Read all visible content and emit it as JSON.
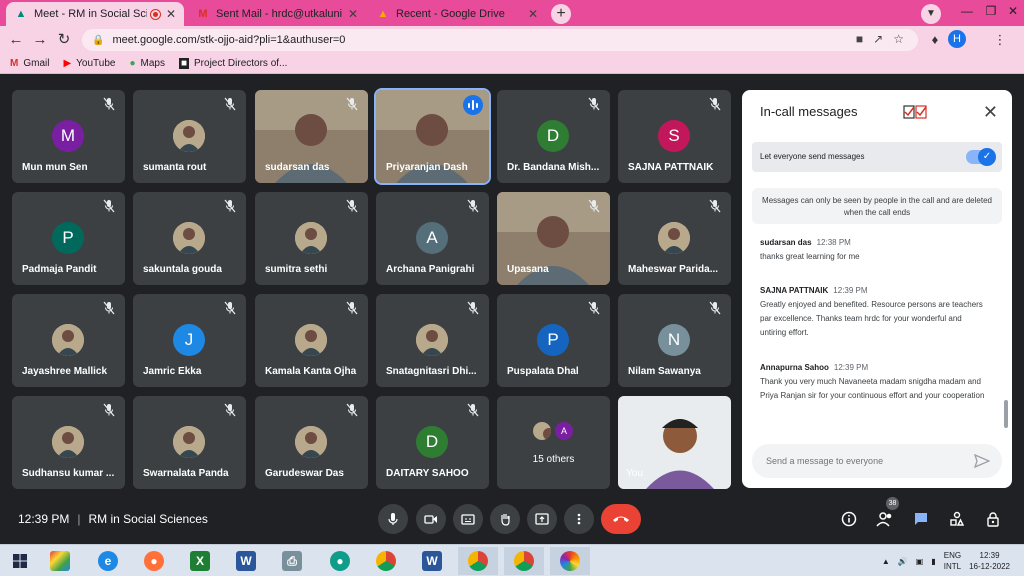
{
  "browser": {
    "tabs": [
      {
        "title": "Meet - RM in Social Sciences",
        "favicon": "meet-icon",
        "active": true,
        "recording": true
      },
      {
        "title": "Sent Mail - hrdc@utkaluniversity",
        "favicon": "gmail-icon",
        "active": false
      },
      {
        "title": "Recent - Google Drive",
        "favicon": "drive-icon",
        "active": false
      }
    ],
    "url": "meet.google.com/stk-ojjo-aid?pli=1&authuser=0",
    "profile_initial": "H",
    "bookmarks": [
      {
        "label": "Gmail",
        "icon": "gmail-icon"
      },
      {
        "label": "YouTube",
        "icon": "youtube-icon"
      },
      {
        "label": "Maps",
        "icon": "maps-icon"
      },
      {
        "label": "Project Directors of...",
        "icon": "site-icon"
      }
    ]
  },
  "participants": [
    {
      "name": "Mun mun Sen",
      "initial": "M",
      "color": "#7b1fa2"
    },
    {
      "name": "sumanta rout",
      "photo": true
    },
    {
      "name": "sudarsan das",
      "video": true
    },
    {
      "name": "Priyaranjan Dash",
      "video": true,
      "speaking": true
    },
    {
      "name": "Dr. Bandana Mish...",
      "initial": "D",
      "color": "#2e7d32"
    },
    {
      "name": "SAJNA PATTNAIK",
      "initial": "S",
      "color": "#c2185b"
    },
    {
      "name": "Padmaja Pandit",
      "initial": "P",
      "color": "#00695c"
    },
    {
      "name": "sakuntala gouda",
      "photo": true
    },
    {
      "name": "sumitra sethi",
      "photo": true
    },
    {
      "name": "Archana Panigrahi",
      "initial": "A",
      "color": "#546e7a"
    },
    {
      "name": "Upasana",
      "video": true
    },
    {
      "name": "Maheswar Parida...",
      "photo": true
    },
    {
      "name": "Jayashree Mallick",
      "photo": true
    },
    {
      "name": "Jamric Ekka",
      "initial": "J",
      "color": "#1e88e5"
    },
    {
      "name": "Kamala Kanta Ojha",
      "photo": true
    },
    {
      "name": "Snatagnitasri Dhi...",
      "photo": true
    },
    {
      "name": "Puspalata Dhal",
      "initial": "P",
      "color": "#1565c0"
    },
    {
      "name": "Nilam Sawanya",
      "initial": "N",
      "color": "#78909c"
    },
    {
      "name": "Sudhansu kumar ...",
      "photo": true
    },
    {
      "name": "Swarnalata Panda",
      "photo": true
    },
    {
      "name": "Garudeswar Das",
      "photo": true
    },
    {
      "name": "DAITARY SAHOO",
      "initial": "D",
      "color": "#2e7d32"
    }
  ],
  "others": {
    "label": "15 others",
    "initial": "A"
  },
  "self_tile": {
    "label": "You"
  },
  "chat": {
    "title": "In-call messages",
    "toggle_label": "Let everyone send messages",
    "toggle_on": true,
    "notice": "Messages can only be seen by people in the call and are deleted when the call ends",
    "messages": [
      {
        "sender": "sudarsan das",
        "time": "12:38 PM",
        "text": "thanks great learning for me"
      },
      {
        "sender": "SAJNA PATTNAIK",
        "time": "12:39 PM",
        "text": "Greatly enjoyed and benefited. Resource persons are teachers par excellence. Thanks team hrdc for your wonderful and untiring effort."
      },
      {
        "sender": "Annapurna Sahoo",
        "time": "12:39 PM",
        "text": "Thank you very much Navaneeta madam snigdha madam and Priya Ranjan sir for your continuous effort and your cooperation"
      }
    ],
    "input_placeholder": "Send a message to everyone"
  },
  "controls": {
    "time": "12:39 PM",
    "meeting_name": "RM in Social Sciences",
    "participant_count": "38"
  },
  "taskbar": {
    "lang_top": "ENG",
    "lang_bottom": "INTL",
    "clock_time": "12:39",
    "clock_date": "16-12-2022"
  }
}
